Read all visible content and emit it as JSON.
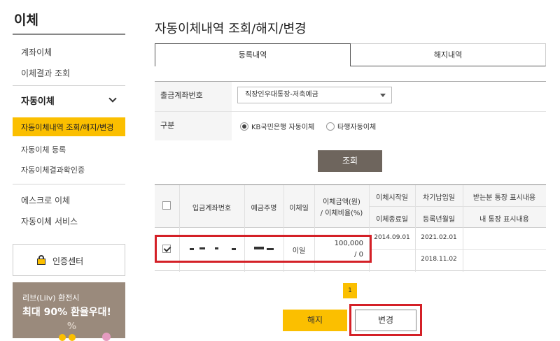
{
  "sidebar": {
    "title": "이체",
    "links": [
      "계좌이체",
      "이체결과 조회"
    ],
    "section": "자동이체",
    "active_item": "자동이체내역 조회/해지/변경",
    "sub_items": [
      "자동이체 등록",
      "자동이체결과확인증"
    ],
    "more_links": [
      "에스크로 이체",
      "자동이체 서비스"
    ],
    "cert_center": "인증센터",
    "banner": {
      "line1": "리브(Liiv) 환전시",
      "line2": "최대 90% 환율우대!",
      "pct": "%"
    }
  },
  "main": {
    "title": "자동이체내역 조회/해지/변경",
    "tabs": [
      "등록내역",
      "해지내역"
    ],
    "form": {
      "account_label": "출금계좌번호",
      "account_value": "직장인우대통장-저축예금",
      "type_label": "구분",
      "radio_options": [
        "KB국민은행 자동이체",
        "타행자동이체"
      ]
    },
    "search_button": "조회",
    "table": {
      "headers": {
        "account": "입금계좌번호",
        "holder": "예금주명",
        "day": "이체일",
        "amount_top": "이체금액(원)",
        "amount_bottom": "/ 이체비율(%)",
        "start": "이체시작일",
        "end": "이체종료일",
        "next_pay": "차기납입일",
        "reg": "등록년월일",
        "recv_memo": "받는분 통장 표시내용",
        "my_memo": "내 통장 표시내용"
      },
      "row": {
        "day": "이일",
        "amount": "100,000",
        "ratio": "/ 0",
        "start": "2014.09.01",
        "next_pay": "2021.02.01",
        "reg": "2018.11.02"
      }
    },
    "page": "1",
    "cancel_button": "해지",
    "change_button": "변경"
  },
  "colors": {
    "accent": "#fbbf00",
    "highlight": "#d42027",
    "search_btn": "#6e655d"
  }
}
